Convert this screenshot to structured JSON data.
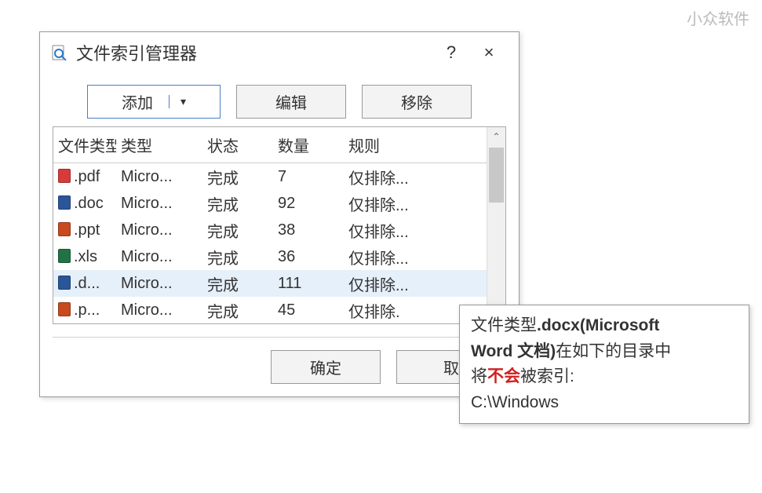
{
  "watermark": "小众软件",
  "dialog": {
    "title": "文件索引管理器",
    "help": "?",
    "close": "×"
  },
  "toolbar": {
    "add_label": "添加",
    "add_caret": "▾",
    "edit_label": "编辑",
    "remove_label": "移除"
  },
  "table": {
    "header": {
      "filetype": "文件类型",
      "type": "类型",
      "status": "状态",
      "qty": "数量",
      "rule": "规则"
    },
    "rows": [
      {
        "icon": "fi-pdf",
        "ext": ".pdf",
        "type": "Micro...",
        "status": "完成",
        "qty": "7",
        "rule": "仅排除..."
      },
      {
        "icon": "fi-doc",
        "ext": ".doc",
        "type": "Micro...",
        "status": "完成",
        "qty": "92",
        "rule": "仅排除..."
      },
      {
        "icon": "fi-ppt",
        "ext": ".ppt",
        "type": "Micro...",
        "status": "完成",
        "qty": "38",
        "rule": "仅排除..."
      },
      {
        "icon": "fi-xls",
        "ext": ".xls",
        "type": "Micro...",
        "status": "完成",
        "qty": "36",
        "rule": "仅排除..."
      },
      {
        "icon": "fi-doc",
        "ext": ".d...",
        "type": "Micro...",
        "status": "完成",
        "qty": "111",
        "rule": "仅排除...",
        "selected": true
      },
      {
        "icon": "fi-ppt",
        "ext": ".p...",
        "type": "Micro...",
        "status": "完成",
        "qty": "45",
        "rule": "仅排除."
      }
    ],
    "scroll_up": "⌃"
  },
  "footer": {
    "ok_label": "确定",
    "cancel_label": "取"
  },
  "tooltip": {
    "l1a": "文件类型",
    "l1b": ".docx(Microsoft ",
    "l2a": "Word 文档)",
    "l2b": "在如下的目录中",
    "l3a": "将",
    "l3b": "不会",
    "l3c": "被索引:",
    "l4": "C:\\Windows"
  }
}
